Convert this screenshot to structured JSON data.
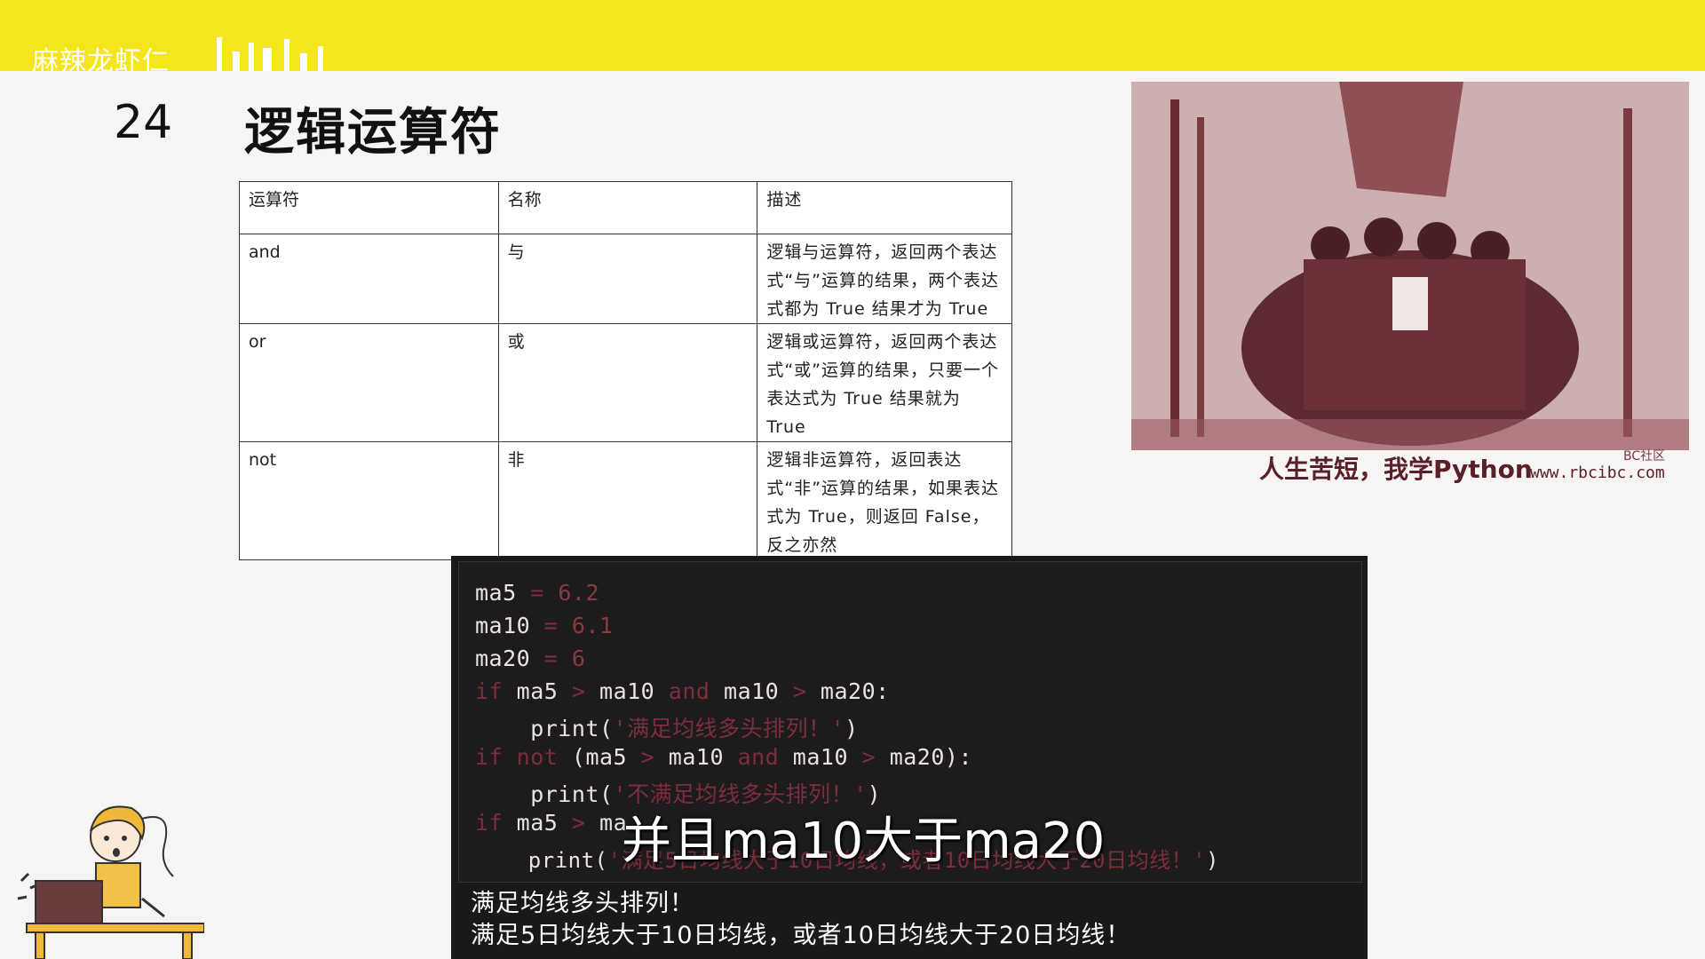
{
  "header": {
    "brand": "麻辣龙虾仁"
  },
  "slide": {
    "number": "24",
    "title": "逻辑运算符"
  },
  "table": {
    "headers": [
      "运算符",
      "名称",
      "描述"
    ],
    "rows": [
      {
        "op": "and",
        "name": "与",
        "desc": "逻辑与运算符，返回两个表达式“与”运算的结果，两个表达式都为 True 结果才为 True"
      },
      {
        "op": "or",
        "name": "或",
        "desc": "逻辑或运算符，返回两个表达式“或”运算的结果，只要一个表达式为 True 结果就为 True"
      },
      {
        "op": "not",
        "name": "非",
        "desc": "逻辑非运算符，返回表达式“非”运算的结果，如果表达式为 True，则返回 False，反之亦然"
      }
    ]
  },
  "photo": {
    "caption": "人生苦短，我学Python",
    "url_text": "www.rbcibc.com",
    "watermark": "BC社区"
  },
  "code": {
    "line1": {
      "a": "ma5",
      "b": "=",
      "c": "6.2"
    },
    "line2": {
      "a": "ma10",
      "b": "=",
      "c": "6.1"
    },
    "line3": {
      "a": "ma20",
      "b": "=",
      "c": "6"
    },
    "line4": {
      "a": "if",
      "b": "ma5",
      "c": ">",
      "d": "ma10",
      "e": "and",
      "f": "ma10",
      "g": ">",
      "h": "ma20:"
    },
    "line5": {
      "a": "    print(",
      "b": "'满足均线多头排列！'",
      "c": ")"
    },
    "line6": {
      "a": "if",
      "b": "not",
      "c": "(ma5",
      "d": ">",
      "e": "ma10",
      "f": "and",
      "g": "ma10",
      "h": ">",
      "i": "ma20):"
    },
    "line7": {
      "a": "    print(",
      "b": "'不满足均线多头排列！'",
      "c": ")"
    },
    "line8": {
      "a": "if",
      "b": "ma5",
      "c": ">",
      "d": "ma"
    },
    "line9": {
      "a": "    print(",
      "b": "'满足5日均线大于10日均线，或者10日均线大于20日均线！'",
      "c": ")"
    }
  },
  "output": {
    "line1": "满足均线多头排列！",
    "line2": "满足5日均线大于10日均线，或者10日均线大于20日均线！"
  },
  "subtitle": "并且ma10大于ma20",
  "colors": {
    "topbar": "#f5e61c",
    "code_bg": "#1a1818",
    "keyword": "#7b2e3c"
  }
}
